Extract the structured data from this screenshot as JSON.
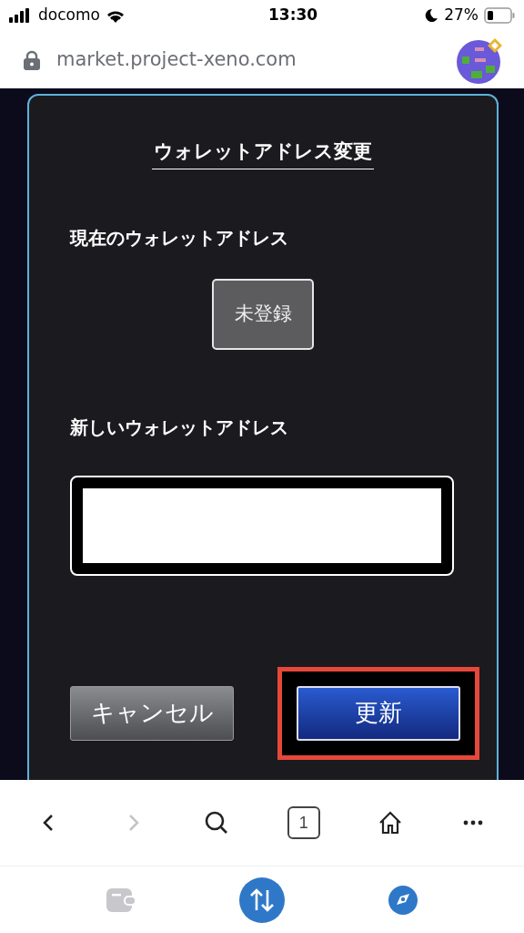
{
  "status_bar": {
    "carrier": "docomo",
    "time": "13:30",
    "battery": "27%"
  },
  "address_bar": {
    "url": "market.project-xeno.com"
  },
  "dialog": {
    "title": "ウォレットアドレス変更",
    "current_label": "現在のウォレットアドレス",
    "current_value": "未登録",
    "new_label": "新しいウォレットアドレス",
    "cancel": "キャンセル",
    "submit": "更新",
    "submit_highlighted": true
  },
  "toolbar": [
    {
      "kind": "back",
      "disabled": false
    },
    {
      "kind": "forward",
      "disabled": true
    },
    {
      "kind": "search",
      "disabled": false
    },
    {
      "kind": "tabs",
      "count": "1",
      "disabled": false
    },
    {
      "kind": "home",
      "disabled": false
    },
    {
      "kind": "more",
      "disabled": false
    }
  ],
  "tab_bar": [
    {
      "kind": "wallet"
    },
    {
      "kind": "swap"
    },
    {
      "kind": "explore"
    }
  ]
}
